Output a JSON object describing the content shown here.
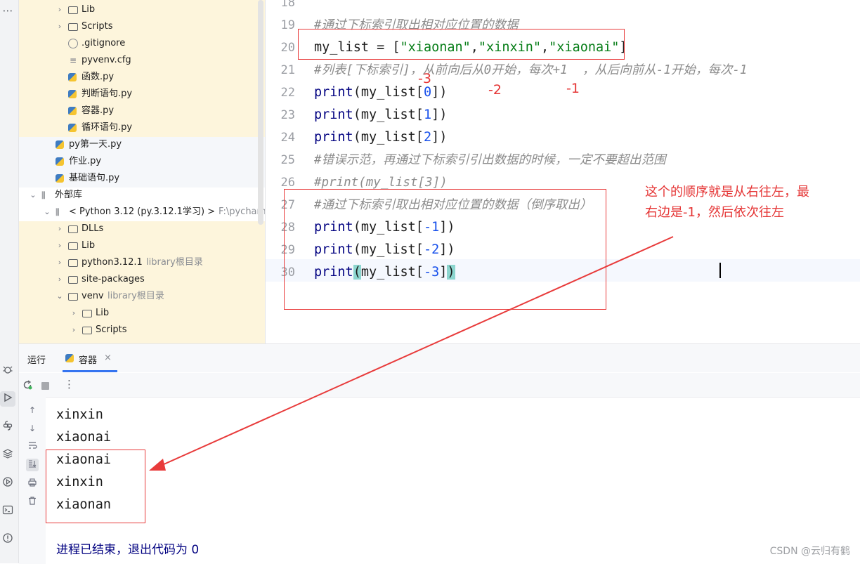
{
  "project_tree": {
    "items": [
      {
        "label": "Lib",
        "type": "folder",
        "depth": 3,
        "expanded": false,
        "has_arrow": true
      },
      {
        "label": "Scripts",
        "type": "folder",
        "depth": 3,
        "expanded": false,
        "has_arrow": true
      },
      {
        "label": ".gitignore",
        "type": "gitignore",
        "depth": 3,
        "has_arrow": false
      },
      {
        "label": "pyvenv.cfg",
        "type": "cfg",
        "depth": 3,
        "has_arrow": false
      },
      {
        "label": "函数.py",
        "type": "python",
        "depth": 3,
        "has_arrow": false
      },
      {
        "label": "判断语句.py",
        "type": "python",
        "depth": 3,
        "has_arrow": false
      },
      {
        "label": "容器.py",
        "type": "python",
        "depth": 3,
        "has_arrow": false
      },
      {
        "label": "循环语句.py",
        "type": "python",
        "depth": 3,
        "has_arrow": false
      },
      {
        "label": "py第一天.py",
        "type": "python",
        "depth": 2,
        "has_arrow": false
      },
      {
        "label": "作业.py",
        "type": "python",
        "depth": 2,
        "has_arrow": false
      },
      {
        "label": "基础语句.py",
        "type": "python",
        "depth": 2,
        "has_arrow": false
      },
      {
        "label": "外部库",
        "type": "library",
        "depth": 1,
        "expanded": true,
        "has_arrow": true
      },
      {
        "label": "< Python 3.12 (py.3.12.1学习) >",
        "suffix": "F:\\pycharm-I",
        "type": "library",
        "depth": 2,
        "expanded": true,
        "has_arrow": true
      },
      {
        "label": "DLLs",
        "type": "folder",
        "depth": 3,
        "expanded": false,
        "has_arrow": true
      },
      {
        "label": "Lib",
        "type": "folder",
        "depth": 3,
        "expanded": false,
        "has_arrow": true
      },
      {
        "label": "python3.12.1",
        "suffix": "library根目录",
        "type": "folder",
        "depth": 3,
        "expanded": false,
        "has_arrow": true
      },
      {
        "label": "site-packages",
        "type": "folder",
        "depth": 3,
        "expanded": false,
        "has_arrow": true
      },
      {
        "label": "venv",
        "suffix": "library根目录",
        "type": "folder",
        "depth": 3,
        "expanded": true,
        "has_arrow": true
      },
      {
        "label": "Lib",
        "type": "folder",
        "depth": 4,
        "expanded": false,
        "has_arrow": true
      },
      {
        "label": "Scripts",
        "type": "folder",
        "depth": 4,
        "expanded": false,
        "has_arrow": true
      }
    ]
  },
  "editor": {
    "lines": [
      {
        "n": "18",
        "html": ""
      },
      {
        "n": "19",
        "html": "<span class=\"cmt\">#通过下标索引取出相对应位置的数据</span>"
      },
      {
        "n": "20",
        "html": "my_list = [<span class=\"str\">\"xiaonan\"</span>,<span class=\"str\">\"xinxin\"</span>,<span class=\"str\">\"xiaonai\"</span>]"
      },
      {
        "n": "21",
        "html": "<span class=\"cmt\">#列表[下标索引]，从前向后从0开始，每次+1  ，从后向前从-1开始，每次-1</span>"
      },
      {
        "n": "22",
        "html": "<span class=\"fn\">print</span>(my_list[<span class=\"num\">0</span>])"
      },
      {
        "n": "23",
        "html": "<span class=\"fn\">print</span>(my_list[<span class=\"num\">1</span>])"
      },
      {
        "n": "24",
        "html": "<span class=\"fn\">print</span>(my_list[<span class=\"num\">2</span>])"
      },
      {
        "n": "25",
        "html": "<span class=\"cmt\">#错误示范，再通过下标索引引出数据的时候，一定不要超出范围</span>"
      },
      {
        "n": "26",
        "html": "<span class=\"cmt\">#print(my_list[3])</span>"
      },
      {
        "n": "27",
        "html": "<span class=\"cmt\">#通过下标索引取出相对应位置的数据（倒序取出）</span>"
      },
      {
        "n": "28",
        "html": "<span class=\"fn\">print</span>(my_list[<span class=\"num\">-1</span>])"
      },
      {
        "n": "29",
        "html": "<span class=\"fn\">print</span>(my_list[<span class=\"num\">-2</span>])"
      },
      {
        "n": "30",
        "html": "<span class=\"fn\">print</span><span class=\"bm\">(</span>my_list[<span class=\"num\">-3</span>]<span class=\"bm\">)</span>"
      }
    ]
  },
  "run_panel": {
    "tab_run": "运行",
    "tab_file": "容器",
    "tab_close": "×",
    "toolbar_more": "⋮",
    "output_lines": [
      "xinxin",
      "xiaonai",
      "xiaonai",
      "xinxin",
      "xiaonan"
    ],
    "exit_message": "进程已结束，退出代码为 0"
  },
  "annotations": {
    "index_neg3": "-3",
    "index_neg2": "-2",
    "index_neg1": "-1",
    "note_line1": "这个的顺序就是从右往左，最",
    "note_line2": "右边是-1，然后依次往左",
    "color": "#e53535"
  },
  "watermark": "CSDN @云归有鹤",
  "toolstrip_top": "⋯"
}
